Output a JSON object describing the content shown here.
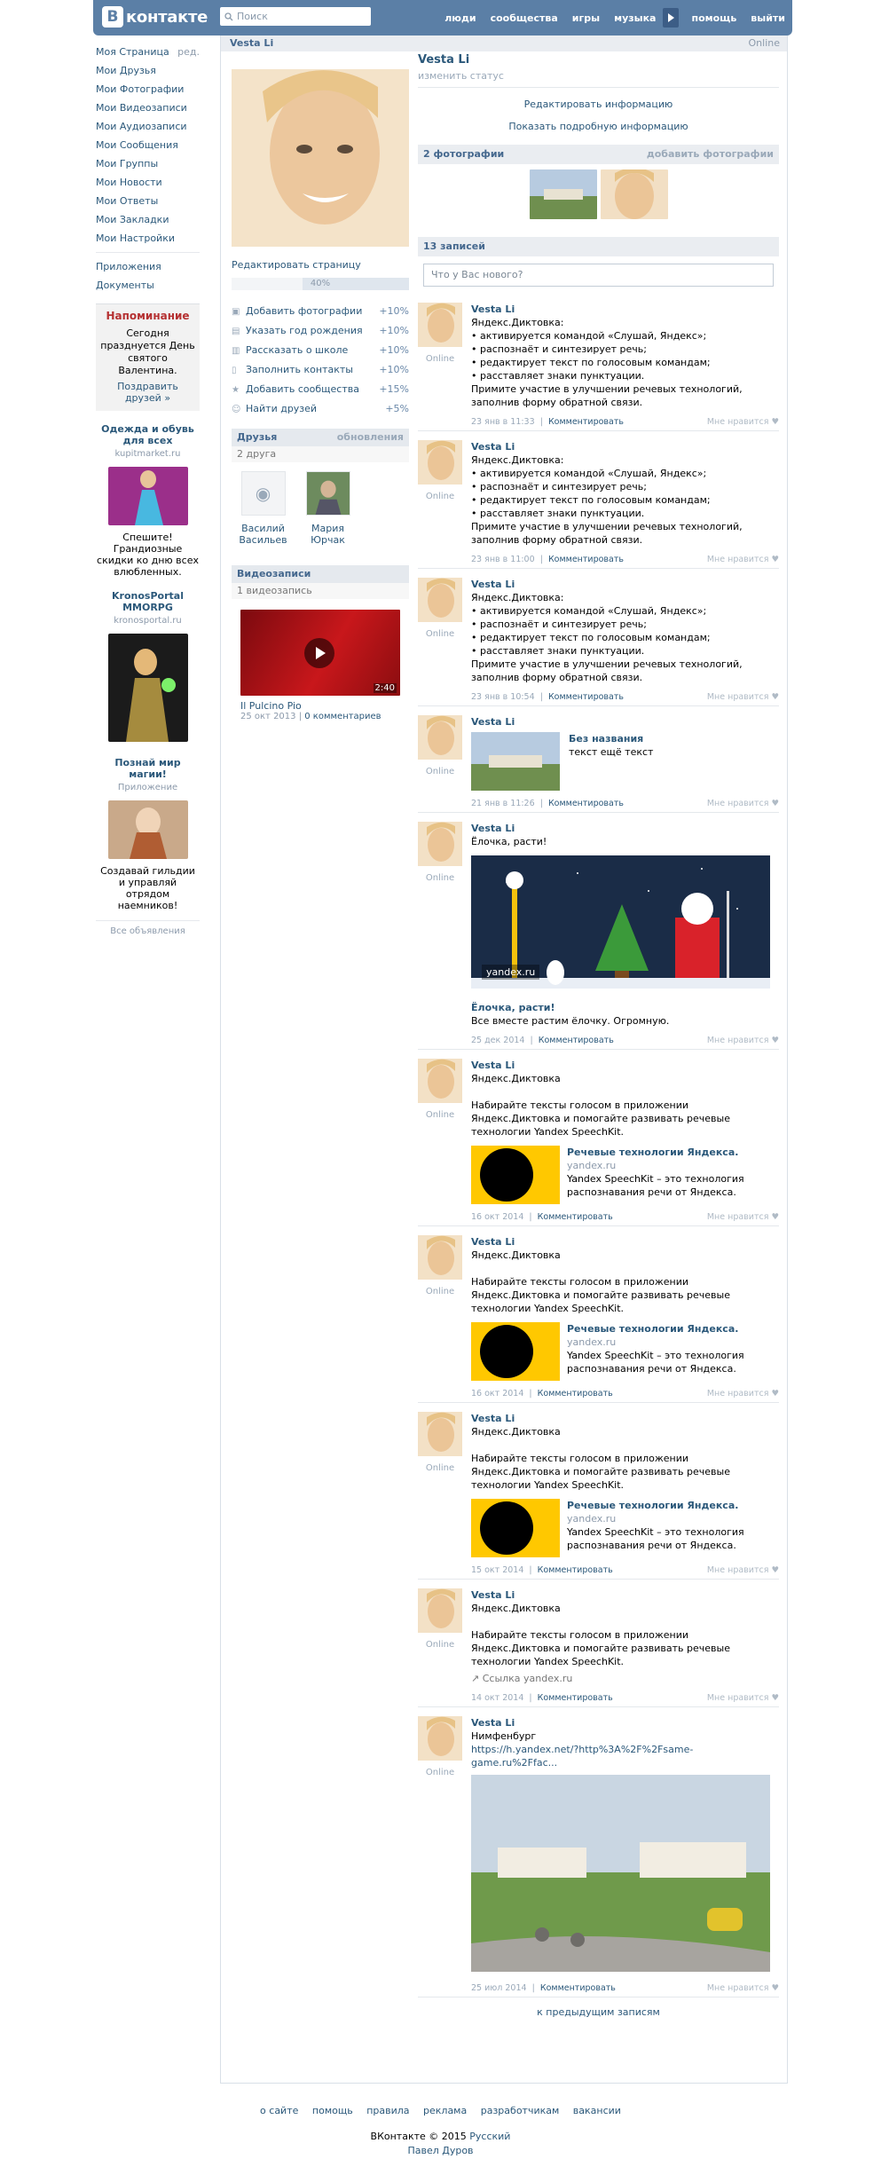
{
  "header": {
    "logo_text": "контакте",
    "logo_letter": "В",
    "search_placeholder": "Поиск",
    "nav": [
      "люди",
      "сообщества",
      "игры",
      "музыка",
      "помощь",
      "выйти"
    ]
  },
  "left_menu": {
    "items": [
      "Моя Страница",
      "Мои Друзья",
      "Мои Фотографии",
      "Мои Видеозаписи",
      "Мои Аудиозаписи",
      "Мои Сообщения",
      "Мои Группы",
      "Мои Новости",
      "Мои Ответы",
      "Мои Закладки",
      "Мои Настройки"
    ],
    "edit_label": "ред.",
    "apps": [
      "Приложения",
      "Документы"
    ],
    "reminder": {
      "title": "Напоминание",
      "body": "Сегодня празднуется День святого Валентина.",
      "link": "Поздравить друзей »"
    },
    "ads": [
      {
        "title": "Одежда и обувь для всех",
        "domain": "kupitmarket.ru",
        "text": "Спешите! Грандиозные скидки ко дню всех влюбленных."
      },
      {
        "title": "KronosPortal MMORPG",
        "domain": "kronosportal.ru",
        "text": ""
      },
      {
        "title": "Познай мир магии!",
        "domain": "Приложение",
        "text": "Создавай гильдии и управляй отрядом наемников!"
      }
    ],
    "all_ads": "Все объявления"
  },
  "profile": {
    "name": "Vesta Li",
    "online": "Online",
    "status": "изменить статус",
    "edit_info": "Редактировать информацию",
    "show_info": "Показать подробную информацию",
    "edit_page": "Редактировать страницу",
    "progress": "40%",
    "progress_value": 0.4,
    "tasks": [
      {
        "icon": "camera-icon",
        "label": "Добавить фотографии",
        "pct": "+10%"
      },
      {
        "icon": "gift-icon",
        "label": "Указать год рождения",
        "pct": "+10%"
      },
      {
        "icon": "school-icon",
        "label": "Рассказать о школе",
        "pct": "+10%"
      },
      {
        "icon": "phone-icon",
        "label": "Заполнить контакты",
        "pct": "+10%"
      },
      {
        "icon": "star-icon",
        "label": "Добавить сообщества",
        "pct": "+15%"
      },
      {
        "icon": "people-icon",
        "label": "Найти друзей",
        "pct": "+5%"
      }
    ],
    "friends_title": "Друзья",
    "friends_updates": "обновления",
    "friends_count": "2 друга",
    "friends": [
      {
        "first": "Василий",
        "last": "Васильев"
      },
      {
        "first": "Мария",
        "last": "Юрчак"
      }
    ],
    "videos_title": "Видеозаписи",
    "videos_count": "1 видеозапись",
    "video": {
      "duration": "2:40",
      "title": "Il Pulcino Pio",
      "date": "25 окт 2013",
      "comments": "0 комментариев"
    },
    "photos_title": "2 фотографии",
    "photos_add": "добавить фотографии",
    "wall_title": "13 записей",
    "new_post_placeholder": "Что у Вас нового?"
  },
  "posts": [
    {
      "author": "Vesta Li",
      "online": "Online",
      "text": "Яндекс.Диктовка:\n• активируется командой «Слушай, Яндекс»;\n• распознаёт и синтезирует речь;\n• редактирует текст по голосовым командам;\n• расставляет знаки пунктуации.\nПримите участие в улучшении речевых технологий, заполнив форму обратной связи.",
      "date": "23 янв в 11:33",
      "comment": "Комментировать",
      "like": "Мне нравится"
    },
    {
      "author": "Vesta Li",
      "online": "Online",
      "text": "Яндекс.Диктовка:\n• активируется командой «Слушай, Яндекс»;\n• распознаёт и синтезирует речь;\n• редактирует текст по голосовым командам;\n• расставляет знаки пунктуации.\nПримите участие в улучшении речевых технологий, заполнив форму обратной связи.",
      "date": "23 янв в 11:00",
      "comment": "Комментировать",
      "like": "Мне нравится"
    },
    {
      "author": "Vesta Li",
      "online": "Online",
      "text": "Яндекс.Диктовка:\n• активируется командой «Слушай, Яндекс»;\n• распознаёт и синтезирует речь;\n• редактирует текст по голосовым командам;\n• расставляет знаки пунктуации.\nПримите участие в улучшении речевых технологий, заполнив форму обратной связи.",
      "date": "23 янв в 10:54",
      "comment": "Комментировать",
      "like": "Мне нравится"
    },
    {
      "author": "Vesta Li",
      "online": "Online",
      "album_title": "Без названия",
      "album_text": "текст ещё текст",
      "date": "21 янв в 11:26",
      "comment": "Комментировать",
      "like": "Мне нравится"
    },
    {
      "author": "Vesta Li",
      "online": "Online",
      "text": "Ёлочка, расти!",
      "img_caption": "yandex.ru",
      "link_title": "Ёлочка, расти!",
      "link_text": "Все вместе растим ёлочку. Огромную.",
      "date": "25 дек 2014",
      "comment": "Комментировать",
      "like": "Мне нравится"
    },
    {
      "author": "Vesta Li",
      "online": "Online",
      "text": "Яндекс.Диктовка\n\nНабирайте тексты голосом в приложении Яндекс.Диктовка и помогайте развивать речевые технологии Yandex SpeechKit.",
      "link_title": "Речевые технологии Яндекса.",
      "link_domain": "yandex.ru",
      "link_text": "Yandex SpeechKit – это технология распознавания речи от Яндекса.",
      "date": "16 окт 2014",
      "comment": "Комментировать",
      "like": "Мне нравится"
    },
    {
      "author": "Vesta Li",
      "online": "Online",
      "text": "Яндекс.Диктовка\n\nНабирайте тексты голосом в приложении Яндекс.Диктовка и помогайте развивать речевые технологии Yandex SpeechKit.",
      "link_title": "Речевые технологии Яндекса.",
      "link_domain": "yandex.ru",
      "link_text": "Yandex SpeechKit – это технология распознавания речи от Яндекса.",
      "date": "16 окт 2014",
      "comment": "Комментировать",
      "like": "Мне нравится"
    },
    {
      "author": "Vesta Li",
      "online": "Online",
      "text": "Яндекс.Диктовка\n\nНабирайте тексты голосом в приложении Яндекс.Диктовка и помогайте развивать речевые технологии Yandex SpeechKit.",
      "link_title": "Речевые технологии Яндекса.",
      "link_domain": "yandex.ru",
      "link_text": "Yandex SpeechKit – это технология распознавания речи от Яндекса.",
      "date": "15 окт 2014",
      "comment": "Комментировать",
      "like": "Мне нравится"
    },
    {
      "author": "Vesta Li",
      "online": "Online",
      "text": "Яндекс.Диктовка\n\nНабирайте тексты голосом в приложении Яндекс.Диктовка и помогайте развивать речевые технологии Yandex SpeechKit.",
      "link_ref": "Ссылка yandex.ru",
      "date": "14 окт 2014",
      "comment": "Комментировать",
      "like": "Мне нравится"
    },
    {
      "author": "Vesta Li",
      "online": "Online",
      "text": "Нимфенбург",
      "url": "https://h.yandex.net/?http%3A%2F%2Fsame-game.ru%2Ffac...",
      "date": "25 июл 2014",
      "comment": "Комментировать",
      "like": "Мне нравится"
    }
  ],
  "more_posts": "к предыдущим записям",
  "footer": {
    "links": [
      "о сайте",
      "помощь",
      "правила",
      "реклама",
      "разработчикам",
      "вакансии"
    ],
    "copyright": "ВКонтакте © 2015",
    "lang": "Русский",
    "author": "Павел Дуров"
  },
  "colors": {
    "header": "#5b7fa6",
    "link": "#2b587a",
    "reminder": "#b53132"
  }
}
